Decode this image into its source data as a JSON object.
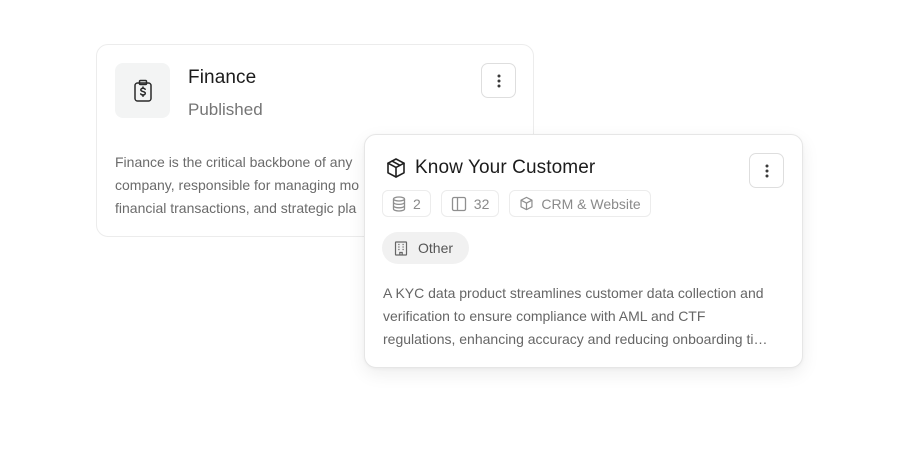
{
  "finance_card": {
    "icon": "clipboard-dollar-icon",
    "title": "Finance",
    "status": "Published",
    "menu_icon": "kebab-vertical-icon",
    "description_lines": [
      "Finance is the critical backbone of any",
      "company, responsible for managing mo",
      "financial transactions, and strategic pla"
    ]
  },
  "kyc_card": {
    "icon": "cube-icon",
    "title": "Know Your Customer",
    "menu_icon": "kebab-vertical-icon",
    "chips": [
      {
        "icon": "database-icon",
        "label": "2"
      },
      {
        "icon": "columns-icon",
        "label": "32"
      },
      {
        "icon": "cube-icon",
        "label": "CRM & Website"
      }
    ],
    "tag": {
      "icon": "building-icon",
      "label": "Other"
    },
    "description_lines": [
      "A KYC data product streamlines customer data collection and",
      "verification to ensure compliance with AML and CTF",
      "regulations, enhancing accuracy and reducing onboarding ti…"
    ]
  }
}
